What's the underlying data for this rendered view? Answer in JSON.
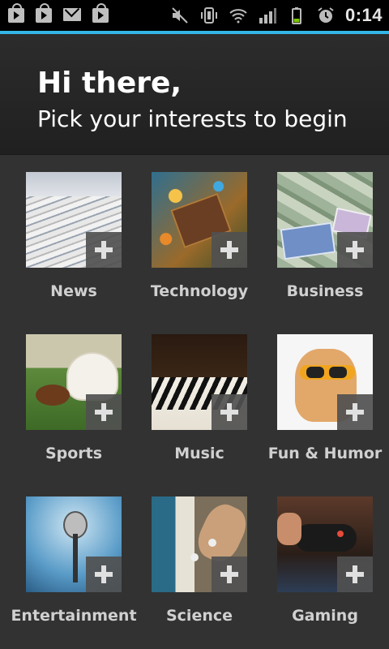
{
  "status_bar": {
    "time": "0:14",
    "icons": [
      "shopping-bag-icon",
      "shopping-bag-icon",
      "gmail-icon",
      "shopping-bag-icon",
      "mute-icon",
      "vibrate-icon",
      "wifi-icon",
      "signal-icon",
      "battery-icon",
      "alarm-icon"
    ]
  },
  "header": {
    "greeting": "Hi there,",
    "subtitle": "Pick your interests to begin"
  },
  "interests": [
    {
      "label": "News",
      "icon": "plus-icon"
    },
    {
      "label": "Technology",
      "icon": "plus-icon"
    },
    {
      "label": "Business",
      "icon": "plus-icon"
    },
    {
      "label": "Sports",
      "icon": "plus-icon"
    },
    {
      "label": "Music",
      "icon": "plus-icon"
    },
    {
      "label": "Fun & Humor",
      "icon": "plus-icon"
    },
    {
      "label": "Entertainment",
      "icon": "plus-icon"
    },
    {
      "label": "Science",
      "icon": "plus-icon"
    },
    {
      "label": "Gaming",
      "icon": "plus-icon"
    }
  ],
  "colors": {
    "accent": "#33b5e5",
    "background": "#323232",
    "header_background": "#252525"
  }
}
